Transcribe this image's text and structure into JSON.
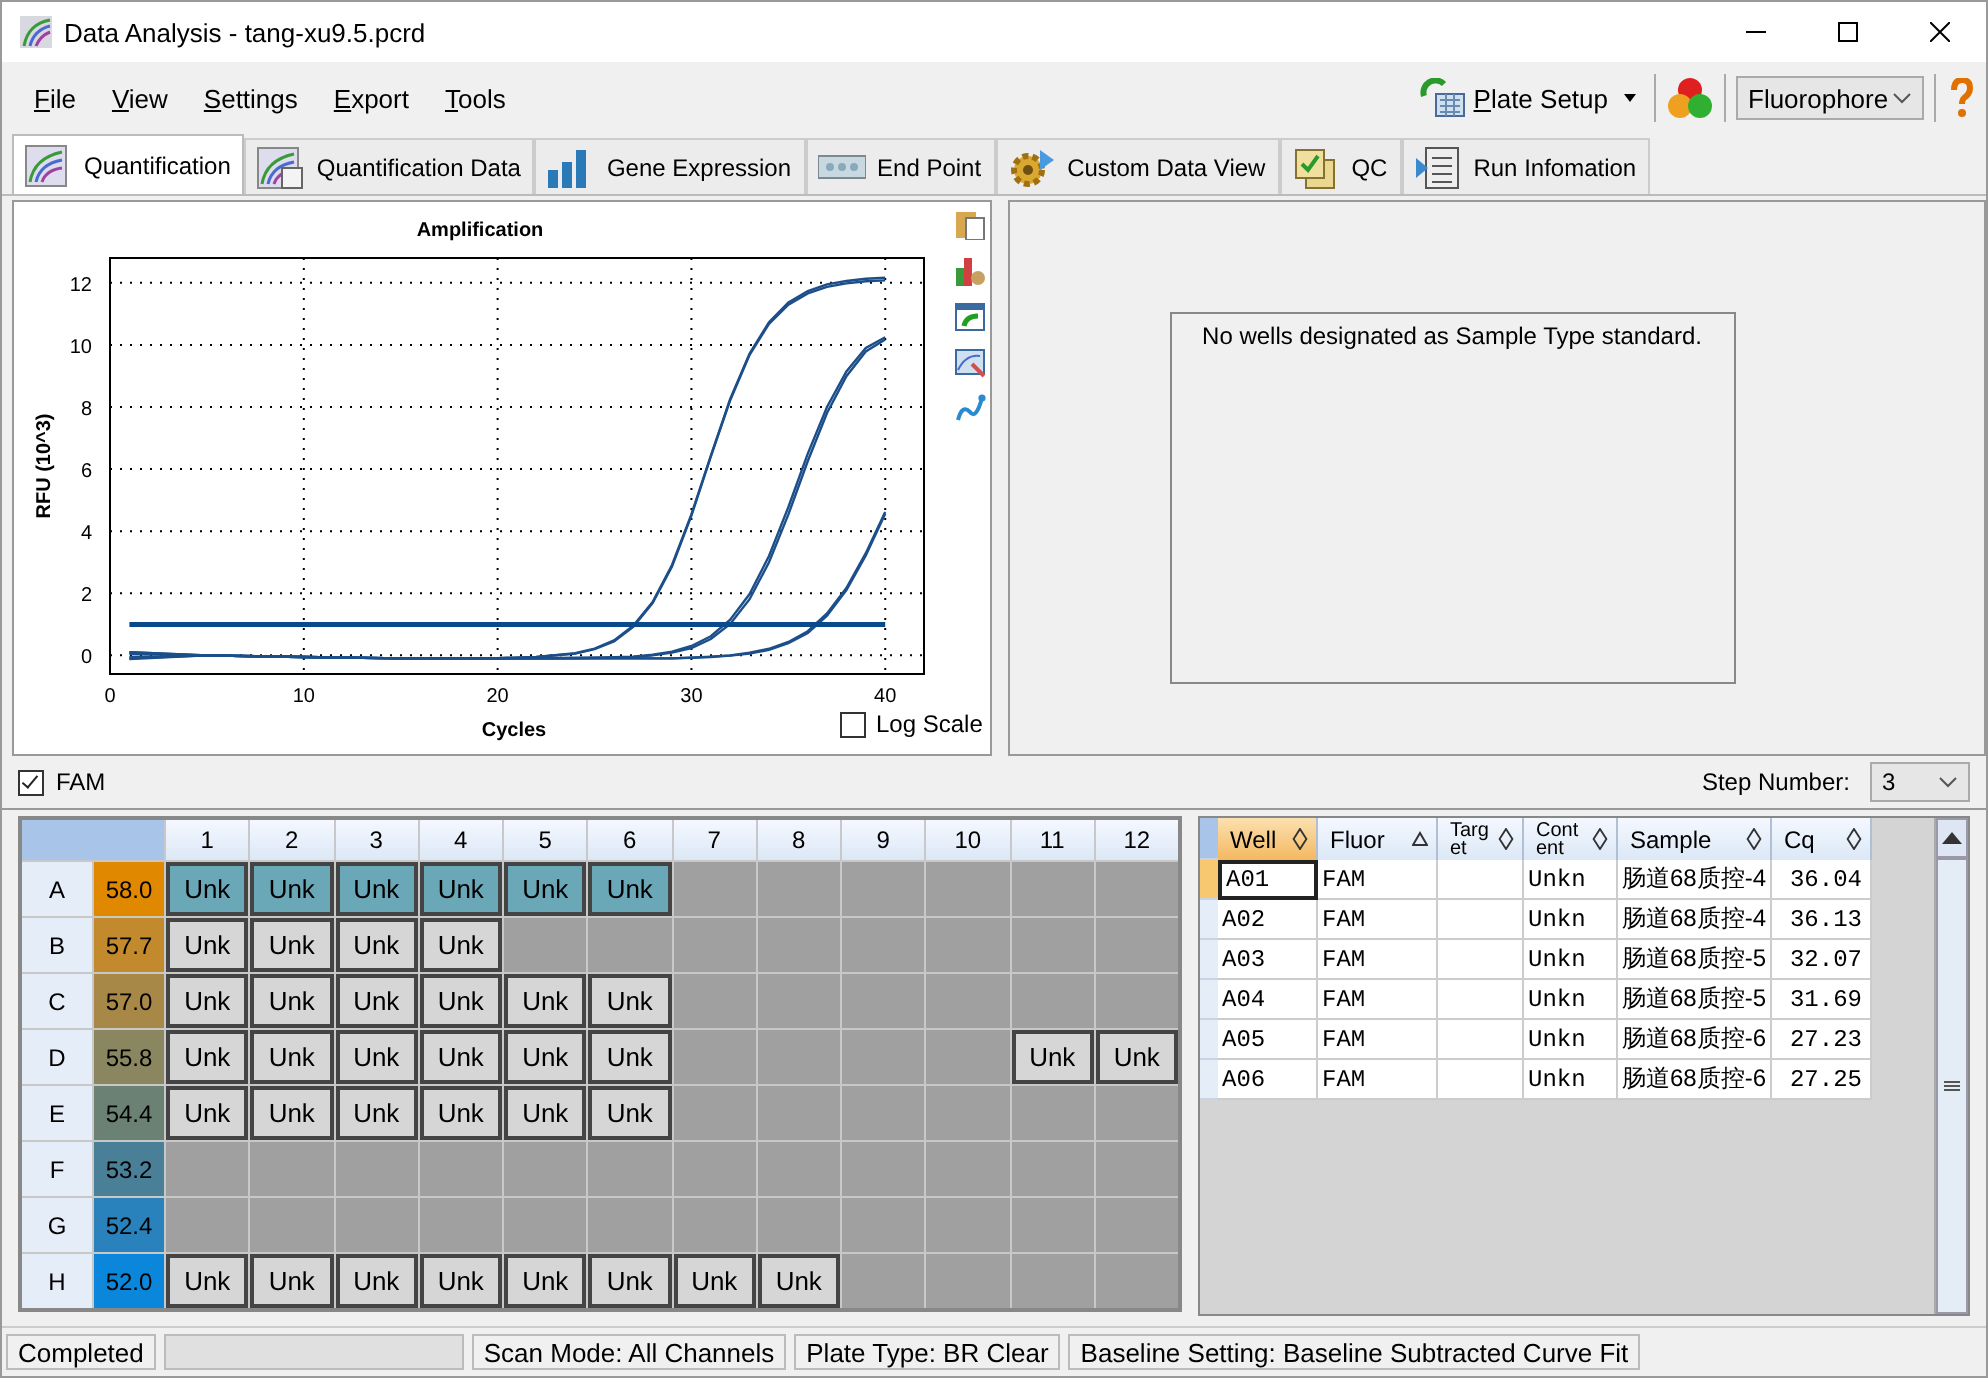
{
  "window": {
    "title": "Data Analysis - tang-xu9.5.pcrd"
  },
  "menu": [
    {
      "label": "File"
    },
    {
      "label": "View"
    },
    {
      "label": "Settings"
    },
    {
      "label": "Export"
    },
    {
      "label": "Tools"
    }
  ],
  "toolbar": {
    "plate_setup": "Plate Setup",
    "view_selector": "Fluorophore"
  },
  "tabs": [
    {
      "label": "Quantification",
      "selected": true
    },
    {
      "label": "Quantification Data",
      "selected": false
    },
    {
      "label": "Gene Expression",
      "selected": false
    },
    {
      "label": "End Point",
      "selected": false
    },
    {
      "label": "Custom Data View",
      "selected": false
    },
    {
      "label": "QC",
      "selected": false
    },
    {
      "label": "Run Infomation",
      "selected": false
    }
  ],
  "amplification": {
    "log_scale": {
      "label": "Log Scale",
      "checked": false
    },
    "chart_data": {
      "type": "line",
      "grid": true,
      "title": "Amplification",
      "xlabel": "Cycles",
      "ylabel": "RFU (10^3)",
      "xlim": [
        0,
        42
      ],
      "ylim": [
        -0.6,
        12.8
      ],
      "xticks": [
        0,
        10,
        20,
        30,
        40
      ],
      "yticks": [
        0,
        2,
        4,
        6,
        8,
        10,
        12
      ],
      "x": [
        1,
        5,
        10,
        15,
        20,
        22,
        24,
        25,
        26,
        27,
        28,
        29,
        30,
        31,
        32,
        33,
        34,
        35,
        36,
        37,
        38,
        39,
        40
      ],
      "series": [
        {
          "color": "#1c4f8a",
          "values": [
            0.1,
            0.0,
            -0.05,
            -0.1,
            -0.1,
            -0.1,
            -0.1,
            -0.1,
            -0.1,
            -0.1,
            -0.1,
            -0.1,
            -0.07,
            -0.04,
            0.0,
            0.08,
            0.21,
            0.43,
            0.78,
            1.35,
            2.17,
            3.29,
            4.62
          ]
        },
        {
          "color": "#1c4f8a",
          "values": [
            -0.05,
            0.0,
            -0.05,
            -0.1,
            -0.1,
            -0.1,
            -0.1,
            -0.1,
            -0.1,
            -0.1,
            -0.1,
            -0.1,
            -0.08,
            -0.05,
            -0.01,
            0.06,
            0.18,
            0.39,
            0.72,
            1.28,
            2.1,
            3.22,
            4.56
          ]
        },
        {
          "color": "#1c4f8a",
          "values": [
            0.05,
            0.0,
            -0.05,
            -0.1,
            -0.1,
            -0.09,
            -0.09,
            -0.08,
            -0.07,
            -0.05,
            0.0,
            0.09,
            0.24,
            0.53,
            1.01,
            1.81,
            3.0,
            4.54,
            6.26,
            7.81,
            8.99,
            9.79,
            10.18
          ]
        },
        {
          "color": "#1c4f8a",
          "values": [
            -0.12,
            0.0,
            -0.05,
            -0.1,
            -0.1,
            -0.09,
            -0.08,
            -0.07,
            -0.06,
            -0.04,
            0.02,
            0.12,
            0.3,
            0.62,
            1.15,
            1.98,
            3.2,
            4.78,
            6.5,
            8.0,
            9.15,
            9.9,
            10.25
          ]
        },
        {
          "color": "#1c4f8a",
          "values": [
            0.1,
            0.0,
            -0.05,
            -0.1,
            -0.09,
            -0.05,
            0.07,
            0.22,
            0.48,
            0.95,
            1.72,
            2.91,
            4.54,
            6.43,
            8.26,
            9.72,
            10.73,
            11.37,
            11.74,
            11.95,
            12.06,
            12.13,
            12.16
          ]
        },
        {
          "color": "#1c4f8a",
          "values": [
            -0.1,
            0.0,
            -0.05,
            -0.1,
            -0.09,
            -0.05,
            0.06,
            0.2,
            0.45,
            0.92,
            1.68,
            2.86,
            4.5,
            6.4,
            8.22,
            9.68,
            10.68,
            11.3,
            11.66,
            11.87,
            11.98,
            12.05,
            12.08
          ]
        },
        {
          "color": "#0b4a8a",
          "values": [
            1,
            1,
            1,
            1,
            1,
            1,
            1,
            1,
            1,
            1,
            1,
            1,
            1,
            1,
            1,
            1,
            1,
            1,
            1,
            1,
            1,
            1,
            1
          ]
        }
      ]
    }
  },
  "standard_curve": {
    "message": "No wells designated as Sample Type standard."
  },
  "fluor_filter": {
    "label": "FAM",
    "checked": true
  },
  "step_number": {
    "label": "Step Number:",
    "value": "3"
  },
  "plate": {
    "columns": [
      "1",
      "2",
      "3",
      "4",
      "5",
      "6",
      "7",
      "8",
      "9",
      "10",
      "11",
      "12"
    ],
    "rows": [
      {
        "label": "A",
        "temp": "58.0",
        "color": "#e08800",
        "wells": [
          {
            "content": "Unk",
            "selected": true
          },
          {
            "content": "Unk",
            "selected": true
          },
          {
            "content": "Unk",
            "selected": true
          },
          {
            "content": "Unk",
            "selected": true
          },
          {
            "content": "Unk",
            "selected": true
          },
          {
            "content": "Unk",
            "selected": true
          },
          {
            "selected": false
          },
          {
            "selected": false
          },
          {
            "selected": false
          },
          {
            "selected": false
          },
          {
            "selected": false
          },
          {
            "selected": false
          }
        ]
      },
      {
        "label": "B",
        "temp": "57.7",
        "color": "#c28a2c",
        "wells": [
          {
            "content": "Unk",
            "selected": false
          },
          {
            "content": "Unk",
            "selected": false
          },
          {
            "content": "Unk",
            "selected": false
          },
          {
            "content": "Unk",
            "selected": false
          },
          {
            "selected": false
          },
          {
            "selected": false
          },
          {
            "selected": false
          },
          {
            "selected": false
          },
          {
            "selected": false
          },
          {
            "selected": false
          },
          {
            "selected": false
          },
          {
            "selected": false
          }
        ]
      },
      {
        "label": "C",
        "temp": "57.0",
        "color": "#a88846",
        "wells": [
          {
            "content": "Unk",
            "selected": false
          },
          {
            "content": "Unk",
            "selected": false
          },
          {
            "content": "Unk",
            "selected": false
          },
          {
            "content": "Unk",
            "selected": false
          },
          {
            "content": "Unk",
            "selected": false
          },
          {
            "content": "Unk",
            "selected": false
          },
          {
            "selected": false
          },
          {
            "selected": false
          },
          {
            "selected": false
          },
          {
            "selected": false
          },
          {
            "selected": false
          },
          {
            "selected": false
          }
        ]
      },
      {
        "label": "D",
        "temp": "55.8",
        "color": "#8a8660",
        "wells": [
          {
            "content": "Unk",
            "selected": false
          },
          {
            "content": "Unk",
            "selected": false
          },
          {
            "content": "Unk",
            "selected": false
          },
          {
            "content": "Unk",
            "selected": false
          },
          {
            "content": "Unk",
            "selected": false
          },
          {
            "content": "Unk",
            "selected": false
          },
          {
            "selected": false
          },
          {
            "selected": false
          },
          {
            "selected": false
          },
          {
            "selected": false
          },
          {
            "content": "Unk",
            "selected": false
          },
          {
            "content": "Unk",
            "selected": false
          }
        ]
      },
      {
        "label": "E",
        "temp": "54.4",
        "color": "#6a8174",
        "wells": [
          {
            "content": "Unk",
            "selected": false
          },
          {
            "content": "Unk",
            "selected": false
          },
          {
            "content": "Unk",
            "selected": false
          },
          {
            "content": "Unk",
            "selected": false
          },
          {
            "content": "Unk",
            "selected": false
          },
          {
            "content": "Unk",
            "selected": false
          },
          {
            "selected": false
          },
          {
            "selected": false
          },
          {
            "selected": false
          },
          {
            "selected": false
          },
          {
            "selected": false
          },
          {
            "selected": false
          }
        ]
      },
      {
        "label": "F",
        "temp": "53.2",
        "color": "#4a7f98",
        "wells": [
          {
            "selected": false
          },
          {
            "selected": false
          },
          {
            "selected": false
          },
          {
            "selected": false
          },
          {
            "selected": false
          },
          {
            "selected": false
          },
          {
            "selected": false
          },
          {
            "selected": false
          },
          {
            "selected": false
          },
          {
            "selected": false
          },
          {
            "selected": false
          },
          {
            "selected": false
          }
        ]
      },
      {
        "label": "G",
        "temp": "52.4",
        "color": "#2a82bc",
        "wells": [
          {
            "selected": false
          },
          {
            "selected": false
          },
          {
            "selected": false
          },
          {
            "selected": false
          },
          {
            "selected": false
          },
          {
            "selected": false
          },
          {
            "selected": false
          },
          {
            "selected": false
          },
          {
            "selected": false
          },
          {
            "selected": false
          },
          {
            "selected": false
          },
          {
            "selected": false
          }
        ]
      },
      {
        "label": "H",
        "temp": "52.0",
        "color": "#0a86da",
        "wells": [
          {
            "content": "Unk",
            "selected": false
          },
          {
            "content": "Unk",
            "selected": false
          },
          {
            "content": "Unk",
            "selected": false
          },
          {
            "content": "Unk",
            "selected": false
          },
          {
            "content": "Unk",
            "selected": false
          },
          {
            "content": "Unk",
            "selected": false
          },
          {
            "content": "Unk",
            "selected": false
          },
          {
            "content": "Unk",
            "selected": false
          },
          {
            "selected": false
          },
          {
            "selected": false
          },
          {
            "selected": false
          },
          {
            "selected": false
          }
        ]
      }
    ]
  },
  "well_table": {
    "columns": [
      {
        "label": "Well",
        "sorted": false,
        "selected": true
      },
      {
        "label": "Fluor",
        "sorted": true,
        "selected": false
      },
      {
        "label": "Target",
        "sorted": false,
        "selected": false
      },
      {
        "label": "Content",
        "sorted": false,
        "selected": false
      },
      {
        "label": "Sample",
        "sorted": false,
        "selected": false
      },
      {
        "label": "Cq",
        "sorted": false,
        "selected": false
      }
    ],
    "rows": [
      {
        "well": "A01",
        "fluor": "FAM",
        "content": "Unkn",
        "sample": "肠道68质控-4",
        "cq": "36.04",
        "selected": true
      },
      {
        "well": "A02",
        "fluor": "FAM",
        "content": "Unkn",
        "sample": "肠道68质控-4",
        "cq": "36.13",
        "selected": false
      },
      {
        "well": "A03",
        "fluor": "FAM",
        "content": "Unkn",
        "sample": "肠道68质控-5",
        "cq": "32.07",
        "selected": false
      },
      {
        "well": "A04",
        "fluor": "FAM",
        "content": "Unkn",
        "sample": "肠道68质控-5",
        "cq": "31.69",
        "selected": false
      },
      {
        "well": "A05",
        "fluor": "FAM",
        "content": "Unkn",
        "sample": "肠道68质控-6",
        "cq": "27.23",
        "selected": false
      },
      {
        "well": "A06",
        "fluor": "FAM",
        "content": "Unkn",
        "sample": "肠道68质控-6",
        "cq": "27.25",
        "selected": false
      }
    ]
  },
  "status_bar": {
    "status": "Completed",
    "progress": {
      "level": 0
    },
    "items": [
      "Scan Mode: All Channels",
      "Plate Type: BR Clear",
      "Baseline Setting: Baseline Subtracted Curve Fit"
    ]
  }
}
